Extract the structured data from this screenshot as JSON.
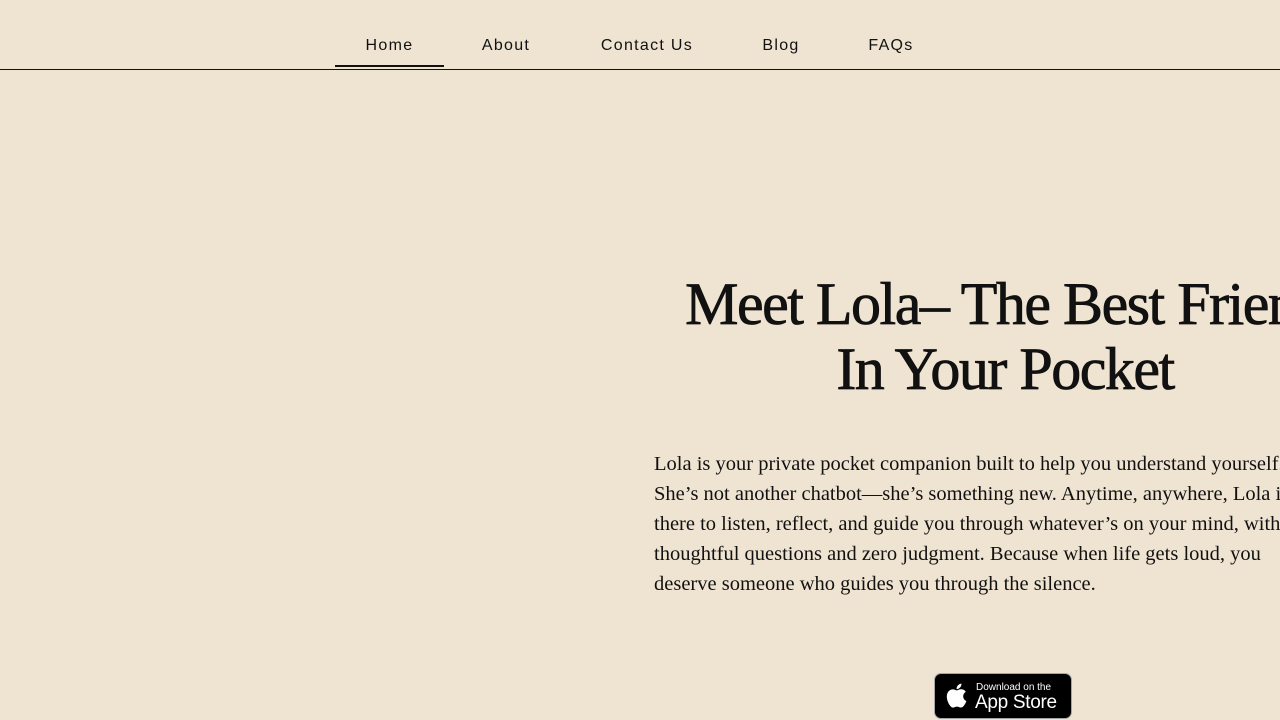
{
  "nav": {
    "items": [
      {
        "label": "Home",
        "active": true
      },
      {
        "label": "About"
      },
      {
        "label": "Contact Us"
      },
      {
        "label": "Blog"
      },
      {
        "label": "FAQs"
      }
    ]
  },
  "hero": {
    "title_line1": "Meet Lola– The Best Friend",
    "title_line2": "In Your Pocket",
    "body_lines": [
      "Lola is your private pocket companion built to help you understand yourself.",
      "She’s not another chatbot—she’s something new. Anytime, anywhere, Lola is",
      "there to listen, reflect, and guide you through whatever’s on your mind, with",
      "thoughtful questions and zero judgment. Because when life gets loud, you",
      "deserve someone who guides you through the silence."
    ]
  },
  "app_store_badge": {
    "small_text": "Download on the",
    "big_text": "App Store",
    "icon": "apple-icon"
  },
  "colors": {
    "background": "#efe3d1",
    "text": "#111111",
    "badge_background": "#000000",
    "badge_border": "#a6a6a6"
  }
}
